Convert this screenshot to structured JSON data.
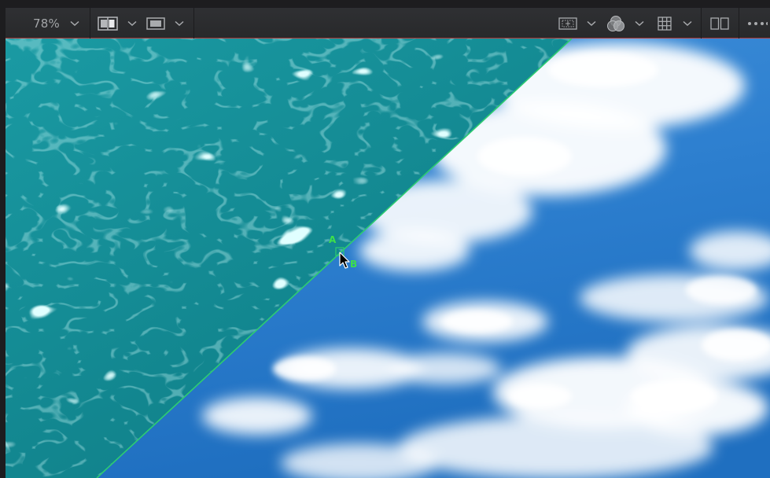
{
  "toolbar": {
    "zoom_value": "78%",
    "icons": {
      "zoom_menu": "chevron-down-icon",
      "split_view": "split-view-icon",
      "overlay": "overlay-icon",
      "safe_area": "safe-area-icon",
      "color_channels": "color-channels-icon",
      "grid": "grid-icon",
      "dual_viewer": "dual-viewer-icon",
      "more": "more-options-icon"
    }
  },
  "viewer": {
    "wipe_label_a": "A",
    "wipe_label_b": "B",
    "image_a": "pool-water",
    "image_b": "cloudy-sky"
  },
  "colors": {
    "toolbar_bg": "#2d2e31",
    "toolbar_accent_line": "#b13c3c",
    "icon_color": "#a9abae",
    "wipe_line": "#2ecc71",
    "water": "#1aa3a8",
    "sky": "#2b78c6"
  }
}
